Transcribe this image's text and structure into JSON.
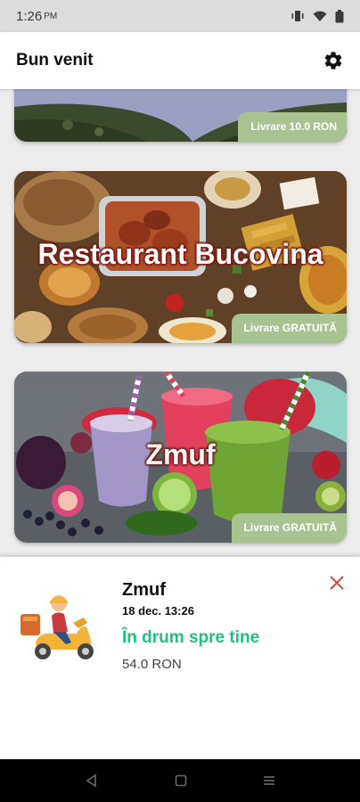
{
  "status_bar": {
    "time": "1:26",
    "ampm": "PM"
  },
  "app_bar": {
    "title": "Bun venit",
    "settings_icon": "gear-icon"
  },
  "restaurants": [
    {
      "name": "",
      "delivery": "Livrare 10.0 RON"
    },
    {
      "name": "Restaurant Bucovina",
      "delivery": "Livrare GRATUITĂ"
    },
    {
      "name": "Zmuf",
      "delivery": "Livrare GRATUITĂ"
    }
  ],
  "active_order": {
    "restaurant": "Zmuf",
    "date": "18 dec. 13:26",
    "status": "În drum spre tine",
    "price": "54.0 RON"
  },
  "colors": {
    "accent_green": "#1fbf7f",
    "badge": "#a8c38f",
    "close": "#d9463a",
    "name_outline": "#7a1a12"
  }
}
